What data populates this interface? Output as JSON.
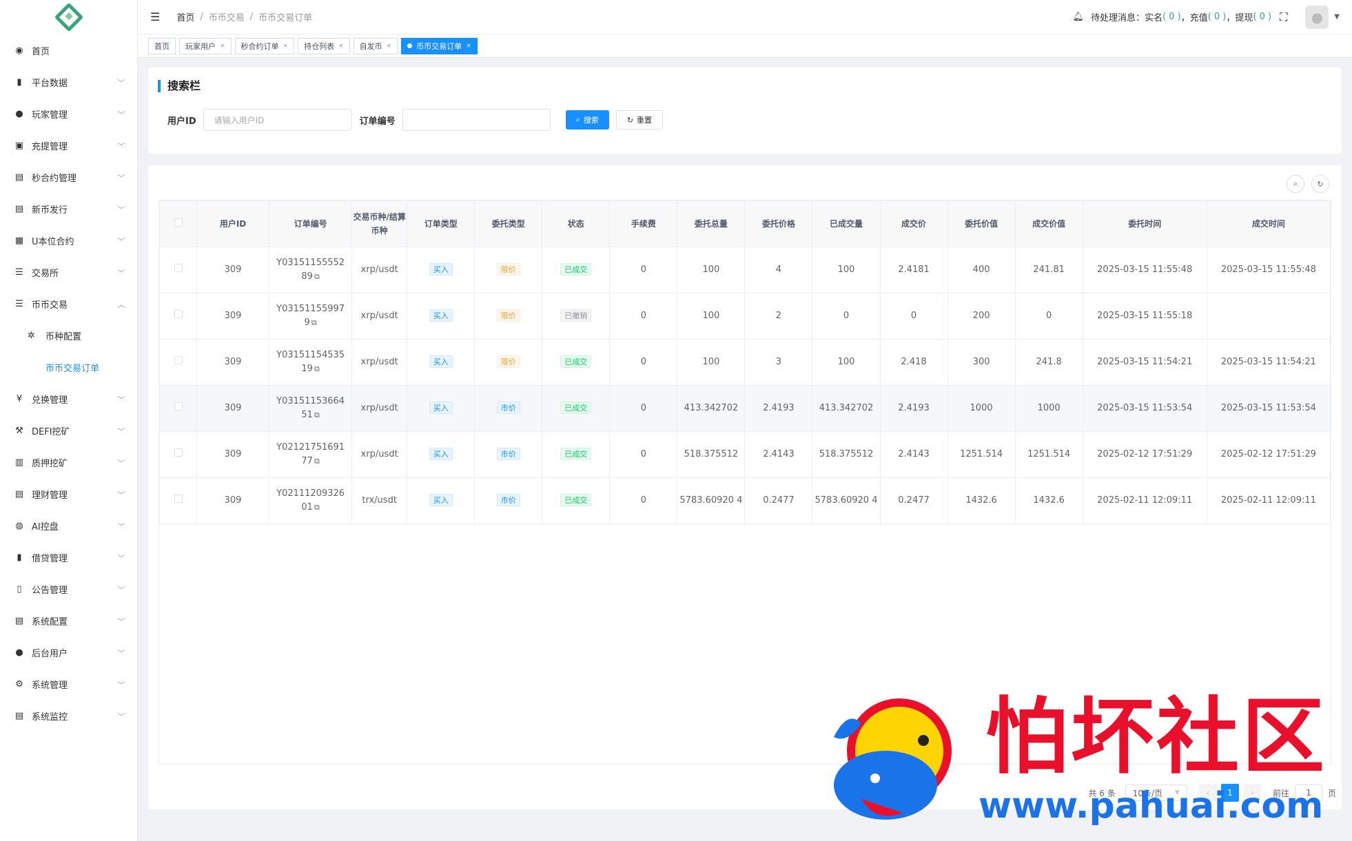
{
  "sidebar": {
    "items": [
      {
        "icon": "dashboard-icon",
        "glyph": "◉",
        "label": "首页",
        "has_children": false
      },
      {
        "icon": "book-icon",
        "glyph": "▮",
        "label": "平台数据",
        "has_children": true
      },
      {
        "icon": "user-icon",
        "glyph": "●",
        "label": "玩家管理",
        "has_children": true
      },
      {
        "icon": "copy-icon",
        "glyph": "▣",
        "label": "充提管理",
        "has_children": true
      },
      {
        "icon": "chart-icon",
        "glyph": "▤",
        "label": "秒合约管理",
        "has_children": true
      },
      {
        "icon": "newspaper-icon",
        "glyph": "▤",
        "label": "新币发行",
        "has_children": true
      },
      {
        "icon": "grid-icon",
        "glyph": "▦",
        "label": "U本位合约",
        "has_children": true
      },
      {
        "icon": "list-icon",
        "glyph": "☰",
        "label": "交易所",
        "has_children": true
      },
      {
        "icon": "list-icon",
        "glyph": "☰",
        "label": "币币交易",
        "has_children": true,
        "expanded": true
      }
    ],
    "sub_items": [
      {
        "icon": "settings-icon",
        "glyph": "✲",
        "label": "币种配置"
      },
      {
        "label": "币币交易订单",
        "active": true
      }
    ],
    "items_after": [
      {
        "icon": "yen-icon",
        "glyph": "¥",
        "label": "兑换管理"
      },
      {
        "icon": "miner-icon",
        "glyph": "⚒",
        "label": "DEFI挖矿"
      },
      {
        "icon": "bar-chart-icon",
        "glyph": "▥",
        "label": "质押挖矿"
      },
      {
        "icon": "document-icon",
        "glyph": "▤",
        "label": "理财管理"
      },
      {
        "icon": "robot-icon",
        "glyph": "◍",
        "label": "AI控盘"
      },
      {
        "icon": "book-icon",
        "glyph": "▮",
        "label": "借贷管理"
      },
      {
        "icon": "open-book-icon",
        "glyph": "▯",
        "label": "公告管理"
      },
      {
        "icon": "document-icon",
        "glyph": "▤",
        "label": "系统配置"
      },
      {
        "icon": "users-icon",
        "glyph": "●",
        "label": "后台用户"
      },
      {
        "icon": "gear-icon",
        "glyph": "⚙",
        "label": "系统管理"
      },
      {
        "icon": "monitor-icon",
        "glyph": "▤",
        "label": "系统监控"
      }
    ]
  },
  "topbar": {
    "breadcrumb": [
      "首页",
      "/",
      "币币交易",
      "/",
      "币币交易订单"
    ],
    "pending_label": "待处理消息：",
    "realname_label": "实名",
    "realname_count": "( 0 )",
    "sep1": "，",
    "recharge_label": "充值",
    "recharge_count": "( 0 )",
    "sep2": "，",
    "withdraw_label": "提现",
    "withdraw_count": "( 0 )"
  },
  "tags": [
    {
      "label": "首页",
      "closable": false,
      "active": false
    },
    {
      "label": "玩家用户",
      "closable": true,
      "active": false
    },
    {
      "label": "秒合约订单",
      "closable": true,
      "active": false
    },
    {
      "label": "持仓列表",
      "closable": true,
      "active": false
    },
    {
      "label": "自发币",
      "closable": true,
      "active": false
    },
    {
      "label": "币币交易订单",
      "closable": true,
      "active": true
    }
  ],
  "search": {
    "title": "搜索栏",
    "user_id_label": "用户ID",
    "user_id_placeholder": "请输入用户ID",
    "order_no_label": "订单编号",
    "order_no_placeholder": "",
    "search_btn": "搜索",
    "reset_btn": "重置"
  },
  "table": {
    "headers": [
      "用户ID",
      "订单编号",
      "交易币种/结算币种",
      "订单类型",
      "委托类型",
      "状态",
      "手续费",
      "委托总量",
      "委托价格",
      "已成交量",
      "成交价",
      "委托价值",
      "成交价值",
      "委托时间",
      "成交时间"
    ],
    "rows": [
      {
        "user_id": "309",
        "order_no_1": "Y03151155552",
        "order_no_2": "89",
        "pair": "xrp/usdt",
        "order_type": "买入",
        "entrust_type": "限价",
        "entrust_kind": "limit",
        "status": "已成交",
        "status_kind": "done",
        "fee": "0",
        "total": "100",
        "price": "4",
        "filled": "100",
        "deal_price": "2.4181",
        "entrust_value": "400",
        "deal_value": "241.81",
        "entrust_time": "2025-03-15 11:55:48",
        "deal_time": "2025-03-15 11:55:48"
      },
      {
        "user_id": "309",
        "order_no_1": "Y03151155997",
        "order_no_2": "9",
        "pair": "xrp/usdt",
        "order_type": "买入",
        "entrust_type": "限价",
        "entrust_kind": "limit",
        "status": "已撤销",
        "status_kind": "cancel",
        "fee": "0",
        "total": "100",
        "price": "2",
        "filled": "0",
        "deal_price": "0",
        "entrust_value": "200",
        "deal_value": "0",
        "entrust_time": "2025-03-15 11:55:18",
        "deal_time": ""
      },
      {
        "user_id": "309",
        "order_no_1": "Y03151154535",
        "order_no_2": "19",
        "pair": "xrp/usdt",
        "order_type": "买入",
        "entrust_type": "限价",
        "entrust_kind": "limit",
        "status": "已成交",
        "status_kind": "done",
        "fee": "0",
        "total": "100",
        "price": "3",
        "filled": "100",
        "deal_price": "2.418",
        "entrust_value": "300",
        "deal_value": "241.8",
        "entrust_time": "2025-03-15 11:54:21",
        "deal_time": "2025-03-15 11:54:21"
      },
      {
        "user_id": "309",
        "order_no_1": "Y03151153664",
        "order_no_2": "51",
        "pair": "xrp/usdt",
        "order_type": "买入",
        "entrust_type": "市价",
        "entrust_kind": "market",
        "status": "已成交",
        "status_kind": "done",
        "fee": "0",
        "total": "413.342702",
        "price": "2.4193",
        "filled": "413.342702",
        "deal_price": "2.4193",
        "entrust_value": "1000",
        "deal_value": "1000",
        "entrust_time": "2025-03-15 11:53:54",
        "deal_time": "2025-03-15 11:53:54",
        "highlight": true
      },
      {
        "user_id": "309",
        "order_no_1": "Y02121751691",
        "order_no_2": "77",
        "pair": "xrp/usdt",
        "order_type": "买入",
        "entrust_type": "市价",
        "entrust_kind": "market",
        "status": "已成交",
        "status_kind": "done",
        "fee": "0",
        "total": "518.375512",
        "price": "2.4143",
        "filled": "518.375512",
        "deal_price": "2.4143",
        "entrust_value": "1251.514",
        "deal_value": "1251.514",
        "entrust_time": "2025-02-12 17:51:29",
        "deal_time": "2025-02-12 17:51:29"
      },
      {
        "user_id": "309",
        "order_no_1": "Y02111209326",
        "order_no_2": "01",
        "pair": "trx/usdt",
        "order_type": "买入",
        "entrust_type": "市价",
        "entrust_kind": "market",
        "status": "已成交",
        "status_kind": "done",
        "fee": "0",
        "total": "5783.60920 4",
        "price": "0.2477",
        "filled": "5783.60920 4",
        "deal_price": "0.2477",
        "entrust_value": "1432.6",
        "deal_value": "1432.6",
        "entrust_time": "2025-02-11 12:09:11",
        "deal_time": "2025-02-11 12:09:11"
      }
    ]
  },
  "pagination": {
    "total_text": "共 6 条",
    "page_size": "10条/页",
    "current_page": "1",
    "goto_label": "前往",
    "goto_value": "1",
    "page_suffix": "页"
  },
  "watermark": {
    "cn_text": "怕坏社区",
    "url_text": "www.pahuai.com"
  },
  "colors": {
    "primary": "#1890ff",
    "success": "#13ce66",
    "warning": "#e6a23c",
    "brand_green": "#3aa37b"
  }
}
